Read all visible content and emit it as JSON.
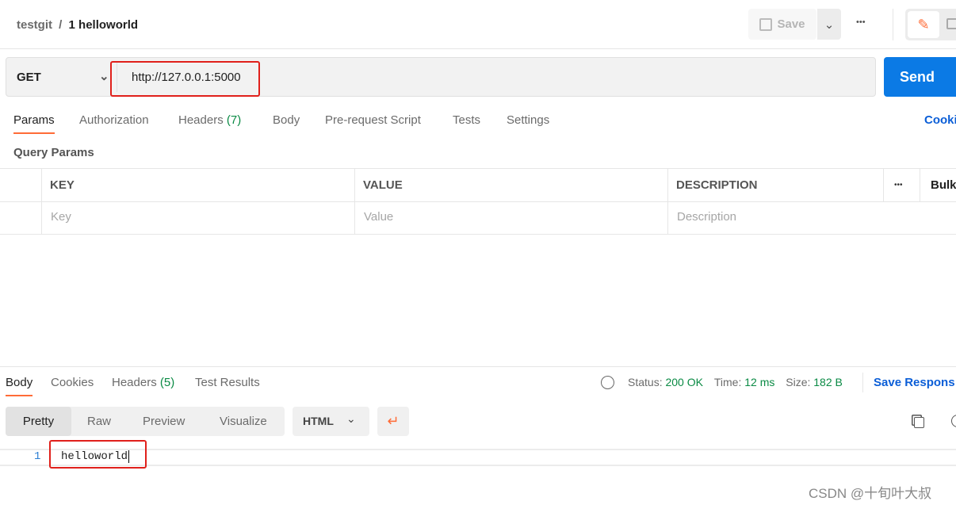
{
  "header": {
    "breadcrumb_parent": "testgit",
    "breadcrumb_sep": "/",
    "title": "1 helloworld",
    "save_label": "Save",
    "more": "•••"
  },
  "request": {
    "method": "GET",
    "url": "http://127.0.0.1:5000",
    "send_label": "Send"
  },
  "req_tabs": [
    {
      "label": "Params"
    },
    {
      "label": "Authorization"
    },
    {
      "label": "Headers",
      "count": "(7)"
    },
    {
      "label": "Body"
    },
    {
      "label": "Pre-request Script"
    },
    {
      "label": "Tests"
    },
    {
      "label": "Settings"
    }
  ],
  "cookies_link": "Cooki",
  "params": {
    "title": "Query Params",
    "columns": [
      "KEY",
      "VALUE",
      "DESCRIPTION"
    ],
    "more": "•••",
    "bulk": "Bulk",
    "placeholders": {
      "key": "Key",
      "value": "Value",
      "description": "Description"
    }
  },
  "resp_tabs": [
    {
      "label": "Body"
    },
    {
      "label": "Cookies"
    },
    {
      "label": "Headers",
      "count": "(5)"
    },
    {
      "label": "Test Results"
    }
  ],
  "status": {
    "status_label": "Status:",
    "status_value": "200 OK",
    "time_label": "Time:",
    "time_value": "12 ms",
    "size_label": "Size:",
    "size_value": "182 B",
    "save_response": "Save Respons"
  },
  "view": {
    "modes": [
      "Pretty",
      "Raw",
      "Preview",
      "Visualize"
    ],
    "format": "HTML"
  },
  "body": {
    "line_number": "1",
    "content": "helloworld"
  },
  "watermark": "CSDN @十旬叶大叔",
  "colors": {
    "accent": "#ff6c37",
    "send": "#0b7ae5",
    "link": "#0b5ed7",
    "success": "#0a8a44",
    "highlight": "#e0201b"
  }
}
